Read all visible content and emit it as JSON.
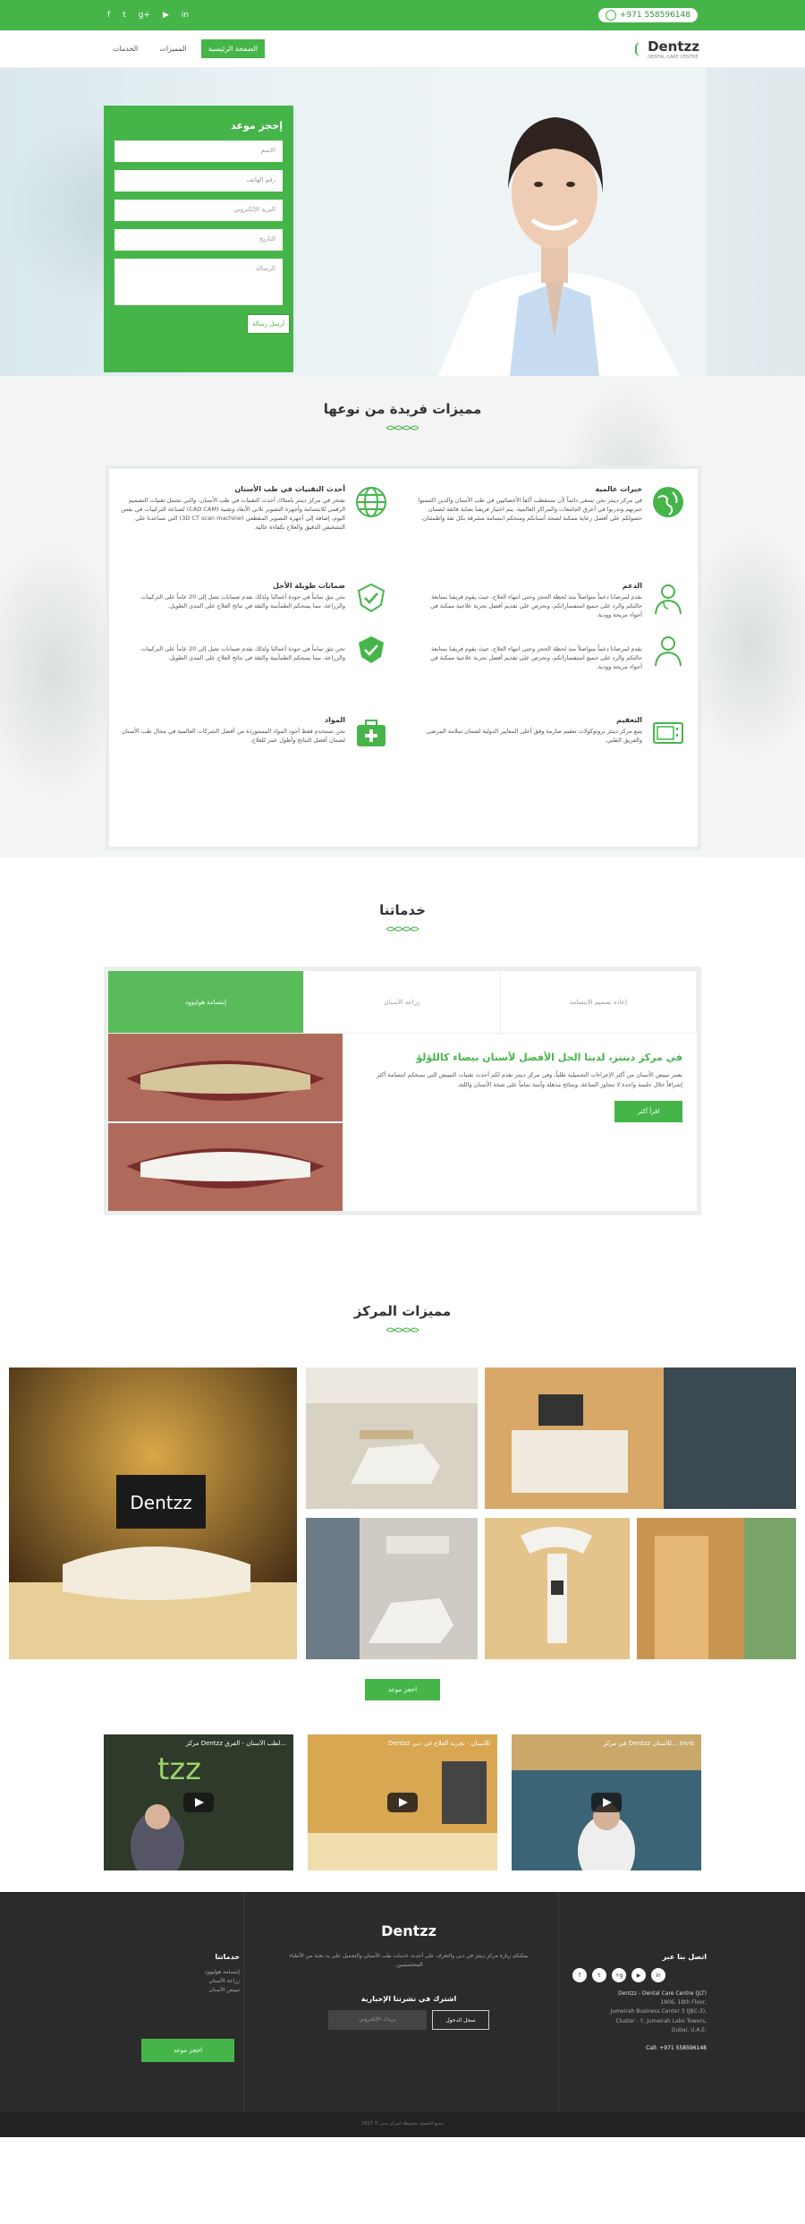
{
  "topbar": {
    "social_icons": [
      "facebook-icon",
      "twitter-icon",
      "googleplus-icon",
      "youtube-icon",
      "linkedin-icon"
    ],
    "social_glyphs": [
      "f",
      "t",
      "g+",
      "▶",
      "in"
    ],
    "phone": "+971 558596148"
  },
  "nav": {
    "items": [
      "الصفحة الرئيسية",
      "المميزات",
      "الخدمات"
    ],
    "logo_text": "Dentzz",
    "logo_tagline": "DENTAL CARE CENTRE"
  },
  "hero": {
    "form_title": "إحجز موعد",
    "fields": [
      "الاسم",
      "رقم الهاتف",
      "البريد الإلكتروني",
      "التاريخ",
      "الرسالة"
    ],
    "submit": "أرسل رسالة"
  },
  "features": {
    "title": "مميزات فريدة من نوعها",
    "items": [
      {
        "title": "خبرات عالمية",
        "text": "في مركز دينتز نحن نسعى دائماً لأن نستقطب أكفأ الأخصائيين في طب الأسنان والذين اكتسبوا خبرتهم وتدربوا في أعرق الجامعات والمراكز العالمية. يتم اختيار فريقنا بعناية فائقة لضمان حصولكم على أفضل رعاية ممكنة لصحة أسنانكم ومنحكم ابتسامة مشرقة بكل ثقة واطمئنان."
      },
      {
        "title": "أحدث التقنيات في طب الأسنان",
        "text": "نفتخر في مركز دينتز بامتلاك أحدث التقنيات في طب الأسنان، والتي تشمل تقنيات التصميم الرقمي للابتسامة وأجهزة التصوير ثلاثي الأبعاد وتقنية (CAD CAM) لصناعة التركيبات في نفس اليوم، إضافة إلى أجهزة التصوير المقطعي (3D CT scan machine) التي تساعدنا على التشخيص الدقيق والعلاج بكفاءة عالية."
      },
      {
        "title": "الدعم",
        "text": "نقدم لمرضانا دعماً متواصلاً منذ لحظة الحجز وحتى انتهاء العلاج، حيث يقوم فريقنا بمتابعة حالتكم والرد على جميع استفساراتكم، ونحرص على تقديم أفضل تجربة علاجية ممكنة في أجواء مريحة وودية."
      },
      {
        "title": "ضمانات طويلة الأجل",
        "text": "نحن نثق تماماً في جودة أعمالنا ولذلك نقدم ضمانات تصل إلى 20 عاماً على التركيبات والزراعة، مما يمنحكم الطمأنينة والثقة في نتائج العلاج على المدى الطويل."
      },
      {
        "title": "التعقيم",
        "text": "يتبع مركز دينتز بروتوكولات تعقيم صارمة وفق أعلى المعايير الدولية لضمان سلامة المرضى والفريق الطبي."
      },
      {
        "title": "المواد",
        "text": "نحن نستخدم فقط أجود المواد المستوردة من أفضل الشركات العالمية في مجال طب الأسنان لضمان أفضل النتائج وأطول عمر للعلاج."
      }
    ]
  },
  "services": {
    "title": "خدماتنا",
    "tabs": [
      "إبتسامة هوليوود",
      "زراعة الأسنان",
      "إعادة تصميم الابتسامة"
    ],
    "active_title": "في مركز دينتز، لدينا الحل الأفضل لأسنان بيضاء كاللؤلؤ",
    "active_text": "يعتبر تبييض الأسنان من أكثر الإجراءات التجميلية طلباً، وفي مركز دينتز نقدم لكم أحدث تقنيات التبييض التي تمنحكم ابتسامة أكثر إشراقاً خلال جلسة واحدة لا تتجاوز الساعة، وبنتائج مذهلة وآمنة تماماً على صحة الأسنان واللثة.",
    "more": "اقرأ أكثر"
  },
  "center": {
    "title": "مميزات المركز",
    "book": "احجز موعد",
    "videos": [
      "مركز Dentzz لطب الأسنان - الفرق...",
      "Dentzz للأسنان - تجربة العلاج في دبي",
      "في مركز Dentzz للأسنان... Invis"
    ]
  },
  "footer": {
    "logo_text": "Dentzz",
    "about": "يمكنكم زيارة مركز دينتز في دبي والتعرف على أحدث خدمات طب الأسنان والتجميل على يد نخبة من الأطباء المتخصصين.",
    "newsletter_title": "اشترك في نشرتنا الإخبارية",
    "newsletter_placeholder": "بريدك الإلكتروني",
    "newsletter_button": "سجل الدخول",
    "services_title": "خدماتنا",
    "services_list": [
      "إبتسامة هوليوود",
      "زراعة الأسنان",
      "تبييض الأسنان"
    ],
    "book": "احجز موعد",
    "contact_title": "اتصل بنا عبر",
    "address_lines": [
      "Dentzz - Dental Care Centre (JLT)",
      "1806, 18th Floor,",
      "Jumeirah Business Center 3 (JBC-3),",
      "Cluster - Y, Jumeirah Lake Towers,",
      "Dubai, U.A.E."
    ],
    "call": "Call: +971 558596148",
    "copyright": "جميع الحقوق محفوظة لمركز دينتز © 2017"
  }
}
